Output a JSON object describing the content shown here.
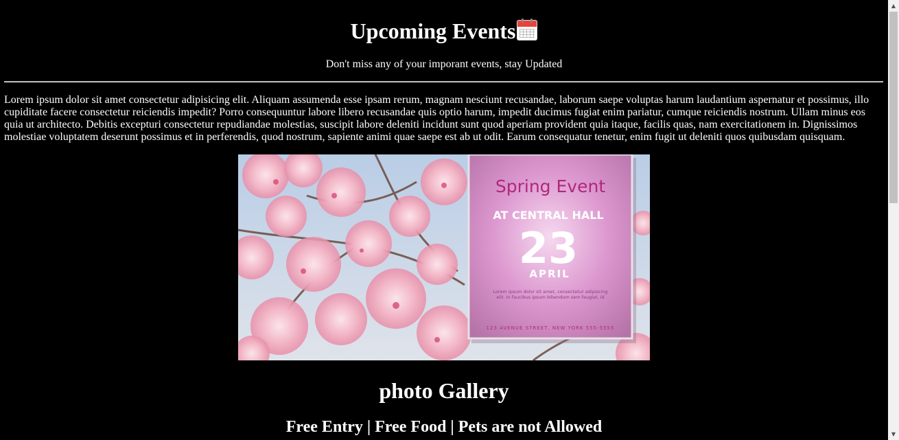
{
  "header": {
    "title": "Upcoming Events",
    "title_icon": "calendar-icon",
    "subtitle": "Don't miss any of your imporant events, stay Updated"
  },
  "intro": {
    "text": "Lorem ipsum dolor sit amet consectetur adipisicing elit. Aliquam assumenda esse ipsam rerum, magnam nesciunt recusandae, laborum saepe voluptas harum laudantium aspernatur et possimus, illo cupiditate facere consectetur reiciendis impedit? Porro consequuntur labore libero recusandae quis optio harum, impedit ducimus fugiat enim pariatur, cumque reiciendis nostrum. Ullam minus eos quia ut architecto. Debitis excepturi consectetur repudiandae molestias, suscipit labore deleniti incidunt sunt quod aperiam provident quia itaque, facilis quas, nam exercitationem in. Dignissimos molestiae voluptatem deserunt possimus et in perferendis, quod nostrum, sapiente animi quae saepe est ab ut odit. Earum consequatur tenetur, enim fugit ut deleniti quos quibusdam quisquam."
  },
  "banner": {
    "event_name": "Spring Event",
    "venue": "AT CENTRAL HALL",
    "day": "23",
    "month": "APRIL",
    "blurb": "Lorem ipsum dolor sit amet, consectetur adipiscing elit. In faucibus ipsum bibendum sem feugiat, id",
    "address": "123 AVENUE STREET, NEW YORK  555-5555"
  },
  "gallery": {
    "title": "photo Gallery",
    "info": "Free Entry | Free Food | Pets are not Allowed"
  },
  "colors": {
    "background": "#000000",
    "text": "#ffffff",
    "poster_title": "#b0287a",
    "poster_pink": "#d890c8"
  }
}
